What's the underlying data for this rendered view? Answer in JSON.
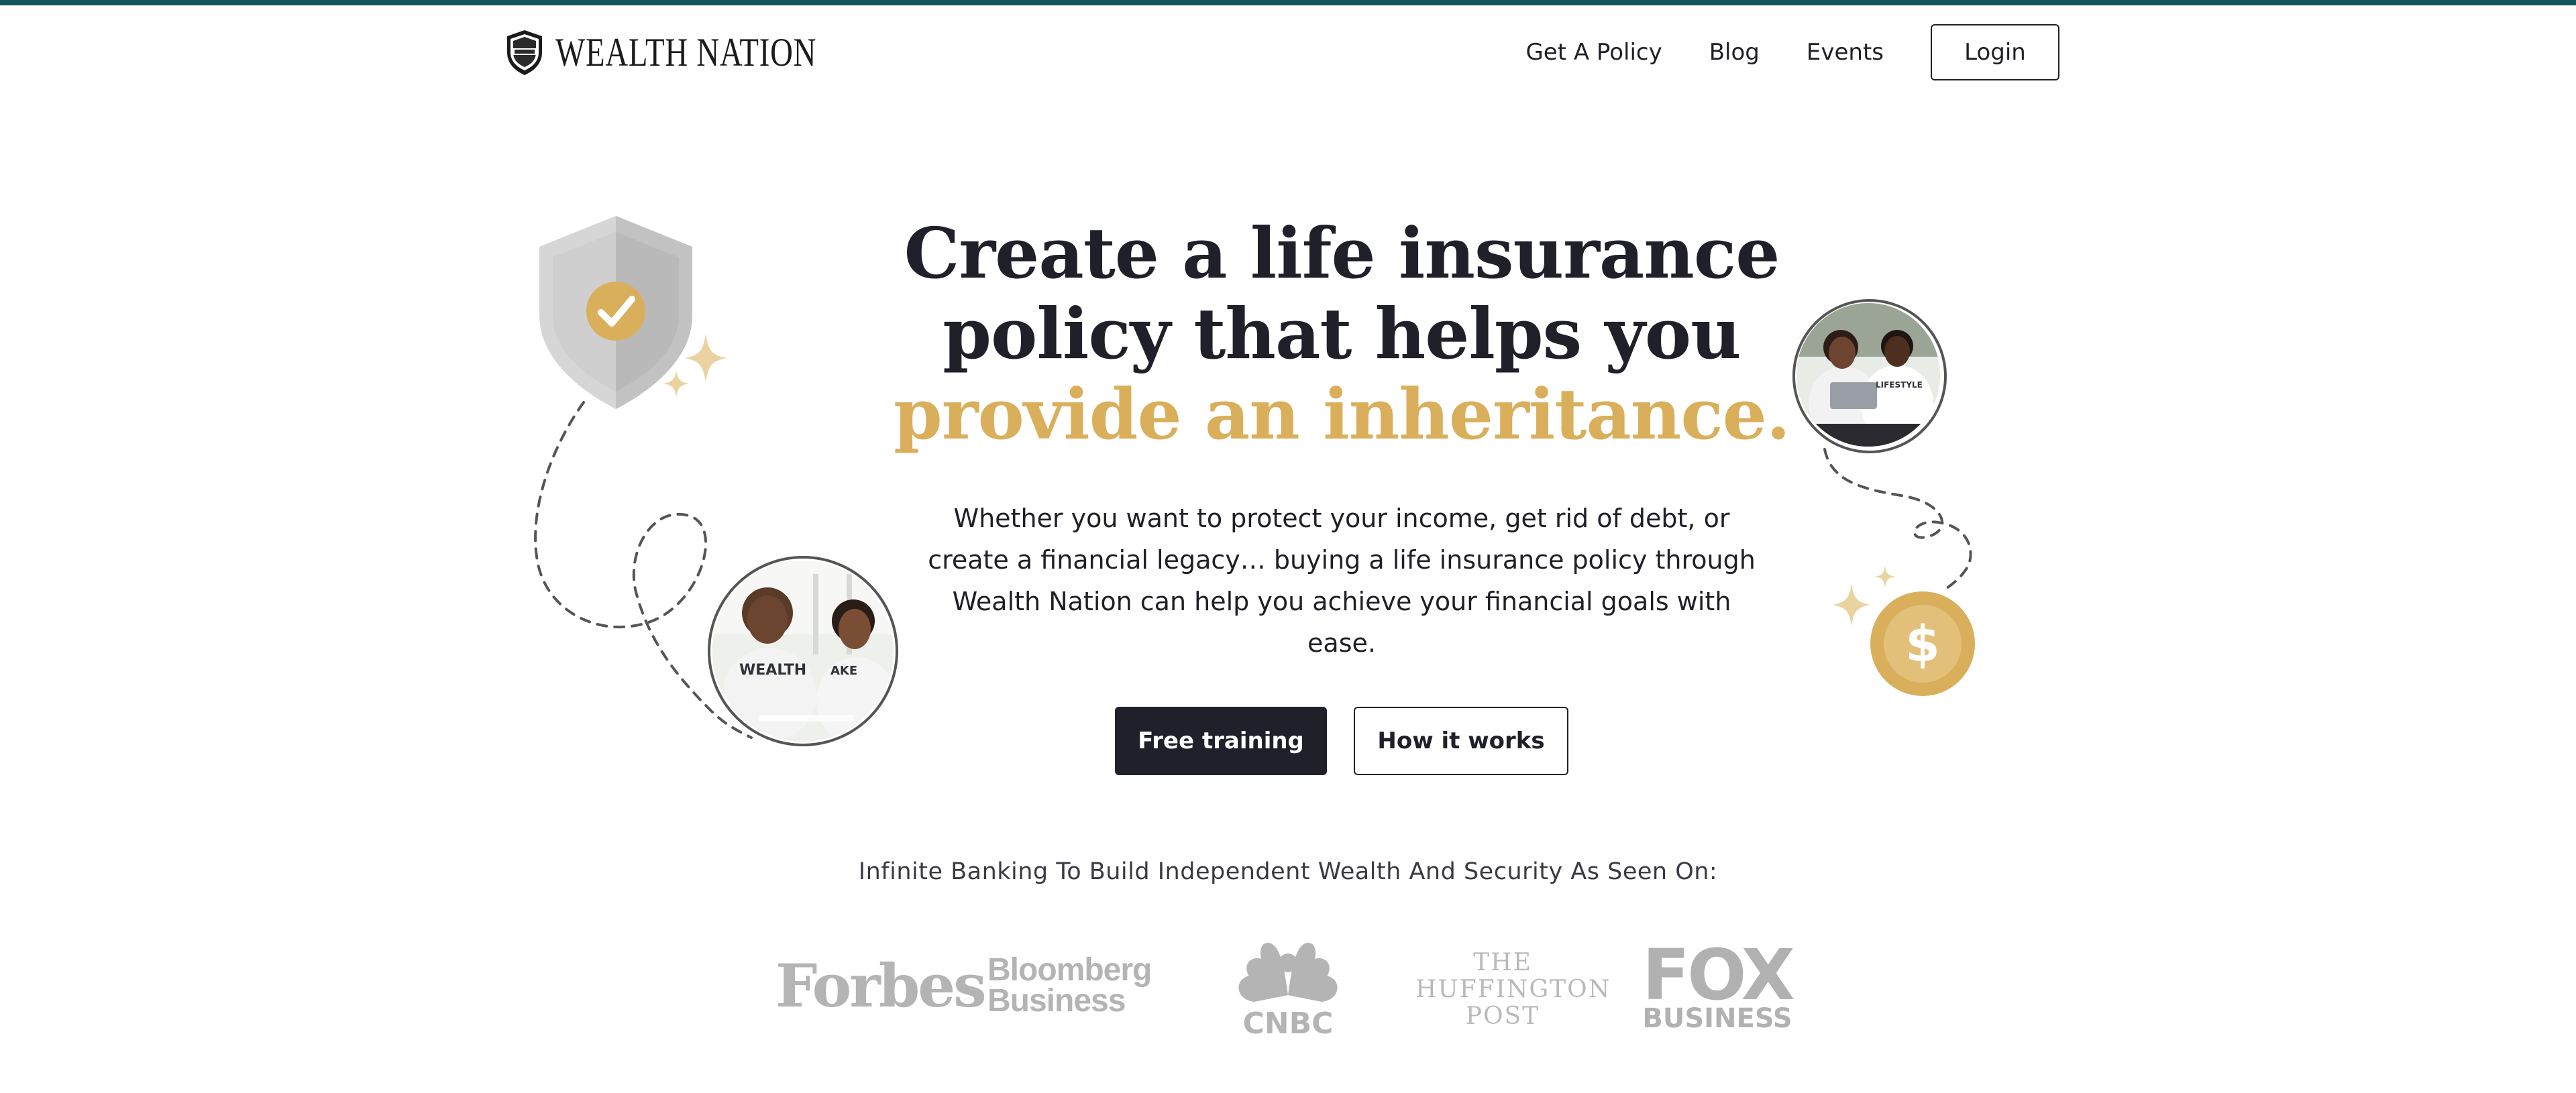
{
  "brand": {
    "name": "WEALTH NATION"
  },
  "nav": {
    "items": [
      {
        "label": "Get A Policy"
      },
      {
        "label": "Blog"
      },
      {
        "label": "Events"
      }
    ],
    "login_label": "Login"
  },
  "hero": {
    "title_line1": "Create a life insurance",
    "title_line2": "policy that helps you",
    "title_highlight": "provide an inheritance.",
    "subtitle": "Whether you want to protect your income, get rid of debt, or create a financial legacy… buying a life insurance policy through Wealth Nation can help you achieve your financial goals with ease.",
    "primary_cta": "Free training",
    "secondary_cta": "How it works"
  },
  "press": {
    "heading": "Infinite Banking To Build Independent Wealth And Security As Seen On:",
    "logos": [
      {
        "name": "Forbes",
        "text": "Forbes"
      },
      {
        "name": "Bloomberg Business",
        "line1": "Bloomberg",
        "line2": "Business"
      },
      {
        "name": "CNBC",
        "text": "CNBC"
      },
      {
        "name": "The Huffington Post",
        "line1": "THE",
        "line2": "HUFFINGTON",
        "line3": "POST"
      },
      {
        "name": "FOX Business",
        "line1": "FOX",
        "line2": "BUSINESS"
      }
    ]
  },
  "photos": {
    "left_shirt_text": "WEALTH",
    "left_shirt_text_2": "AKE",
    "right_shirt_text": "LIFESTYLE"
  },
  "colors": {
    "accent_gold": "#d9af5b",
    "dark": "#20202a",
    "top_stripe": "#115460",
    "logo_gray": "#b4b4b4"
  },
  "icons": [
    "shield-check-icon",
    "sparkle-icon",
    "dollar-coin-icon"
  ]
}
